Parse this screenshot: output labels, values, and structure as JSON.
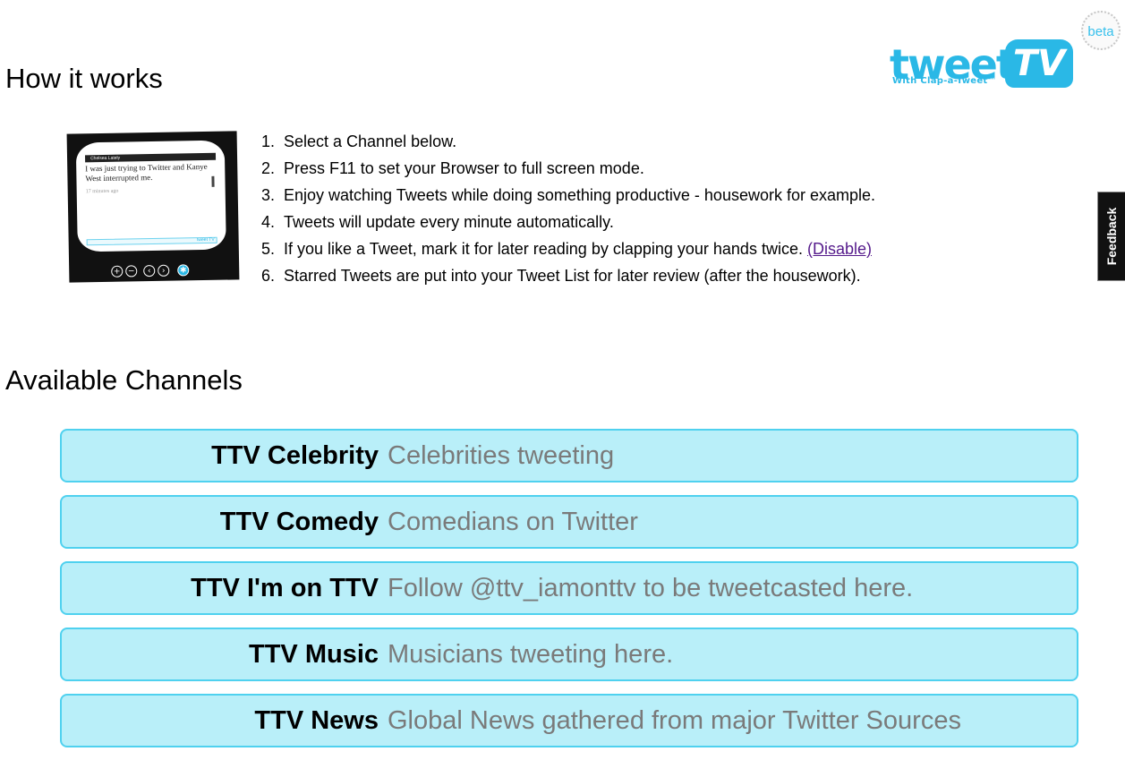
{
  "logo": {
    "word": "tweet",
    "tv": "TV",
    "tagline": "With Clap-a-Tweet™",
    "badge": "beta",
    "color": "#2ab8e6"
  },
  "how_it_works": {
    "heading": "How it works",
    "tv_preview": {
      "author": "Chelsea Lately",
      "tweet": "I was just trying to Twitter and Kanye West interrupted me.",
      "time": "17 minutes ago",
      "bar_logo": "tweet TV",
      "controls": [
        "plus-icon",
        "minus-icon",
        "prev-icon",
        "next-icon",
        "star-icon"
      ]
    },
    "steps": [
      {
        "num": "1.",
        "text": "Select a Channel below."
      },
      {
        "num": "2.",
        "text": "Press F11 to set your Browser to full screen mode."
      },
      {
        "num": "3.",
        "text": "Enjoy watching Tweets while doing something productive - housework for example."
      },
      {
        "num": "4.",
        "text": "Tweets will update every minute automatically."
      },
      {
        "num": "5.",
        "text": "If you like a Tweet, mark it for later reading by clapping your hands twice. ",
        "link": "(Disable)"
      },
      {
        "num": "6.",
        "text": "Starred Tweets are put into your Tweet List for later review (after the housework)."
      }
    ]
  },
  "feedback": {
    "label": "Feedback"
  },
  "channels": {
    "heading": "Available Channels",
    "colors": {
      "fill": "#b9eff9",
      "border": "#4fd1ef",
      "desc": "#7a7a7a"
    },
    "items": [
      {
        "name": "TTV Celebrity",
        "desc": "Celebrities tweeting"
      },
      {
        "name": "TTV Comedy",
        "desc": "Comedians on Twitter"
      },
      {
        "name": "TTV I'm on TTV",
        "desc": "Follow @ttv_iamonttv to be tweetcasted here."
      },
      {
        "name": "TTV Music",
        "desc": "Musicians tweeting here."
      },
      {
        "name": "TTV News",
        "desc": "Global News gathered from major Twitter Sources"
      }
    ]
  }
}
